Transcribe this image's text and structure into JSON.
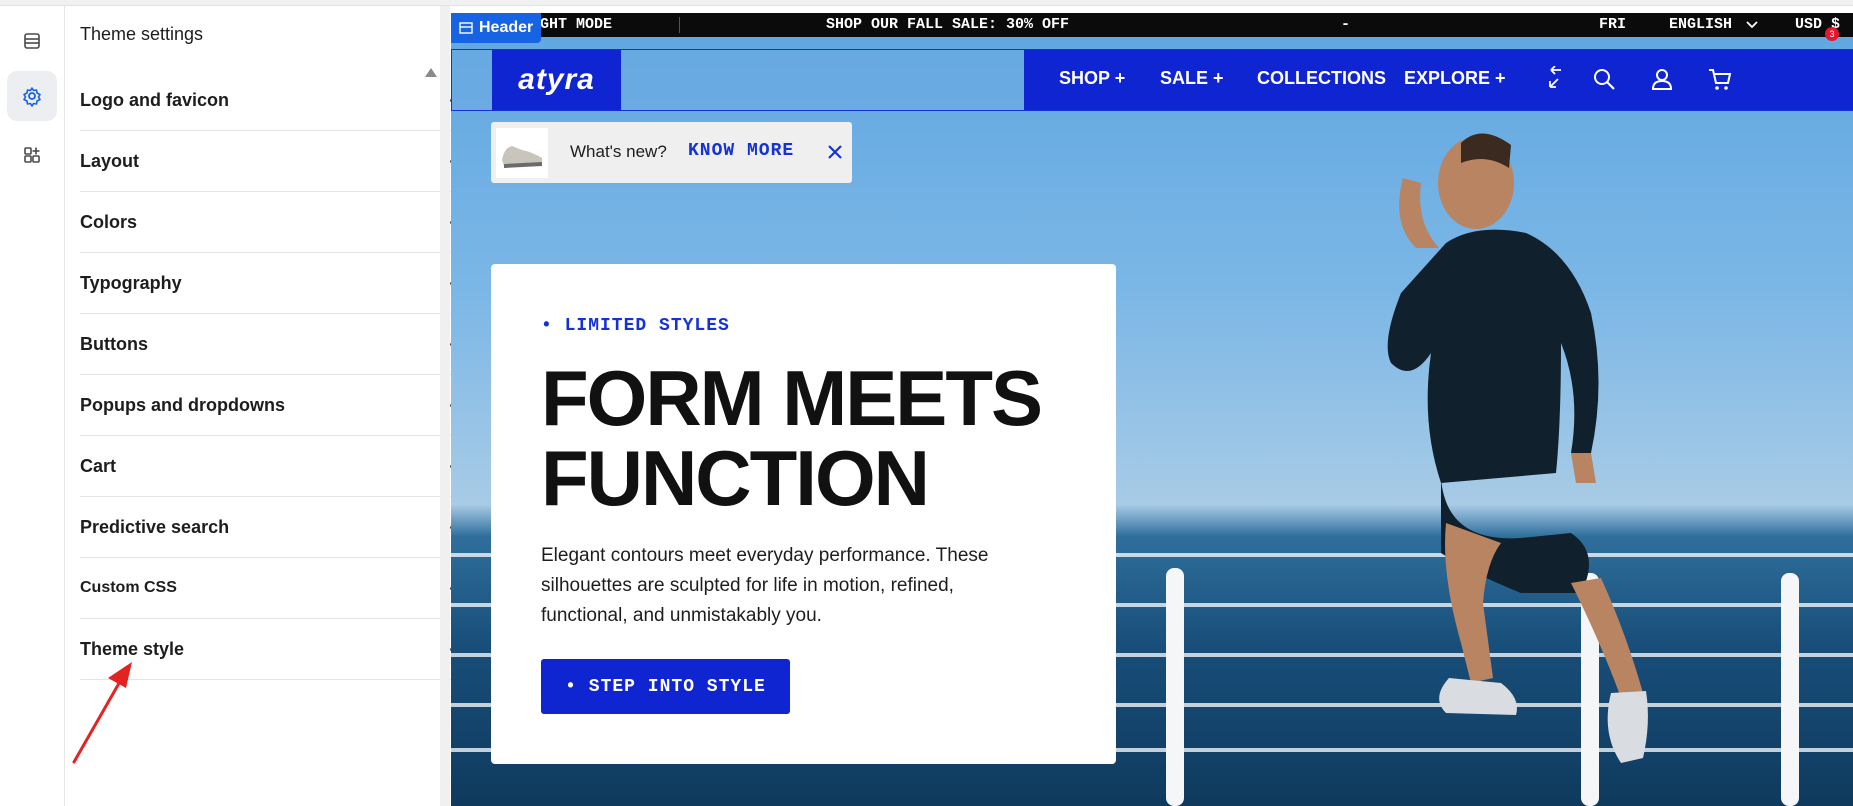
{
  "sidebar": {
    "title": "Theme settings",
    "items": [
      {
        "label": "Logo and favicon"
      },
      {
        "label": "Layout"
      },
      {
        "label": "Colors"
      },
      {
        "label": "Typography"
      },
      {
        "label": "Buttons"
      },
      {
        "label": "Popups and dropdowns"
      },
      {
        "label": "Cart"
      },
      {
        "label": "Predictive search"
      },
      {
        "label": "Custom CSS"
      },
      {
        "label": "Theme style"
      }
    ]
  },
  "rail": {
    "icons": [
      "sections-icon",
      "gear-icon",
      "apps-icon"
    ],
    "active": "gear-icon"
  },
  "preview": {
    "section_tag": "Header",
    "announcement": {
      "left": "IGHT MODE",
      "center": "SHOP OUR FALL SALE: 30% OFF",
      "dash": "-",
      "right_cut": "FRI",
      "language": "ENGLISH",
      "currency": "USD $"
    },
    "logo": "atyra",
    "nav": [
      "SHOP +",
      "SALE +",
      "COLLECTIONS",
      "EXPLORE +"
    ],
    "cart_count": "3",
    "whats_new": {
      "text": "What's new?",
      "link": "KNOW MORE"
    },
    "hero": {
      "eyebrow": "• LIMITED STYLES",
      "headline": "FORM MEETS\nFUNCTION",
      "body": "Elegant contours meet everyday performance. These silhouettes are sculpted for life in motion, refined, functional, and unmistakably you.",
      "cta": "• STEP INTO STYLE"
    },
    "colors": {
      "brand_blue": "#0f25d2",
      "accent_red": "#e5172f"
    }
  }
}
